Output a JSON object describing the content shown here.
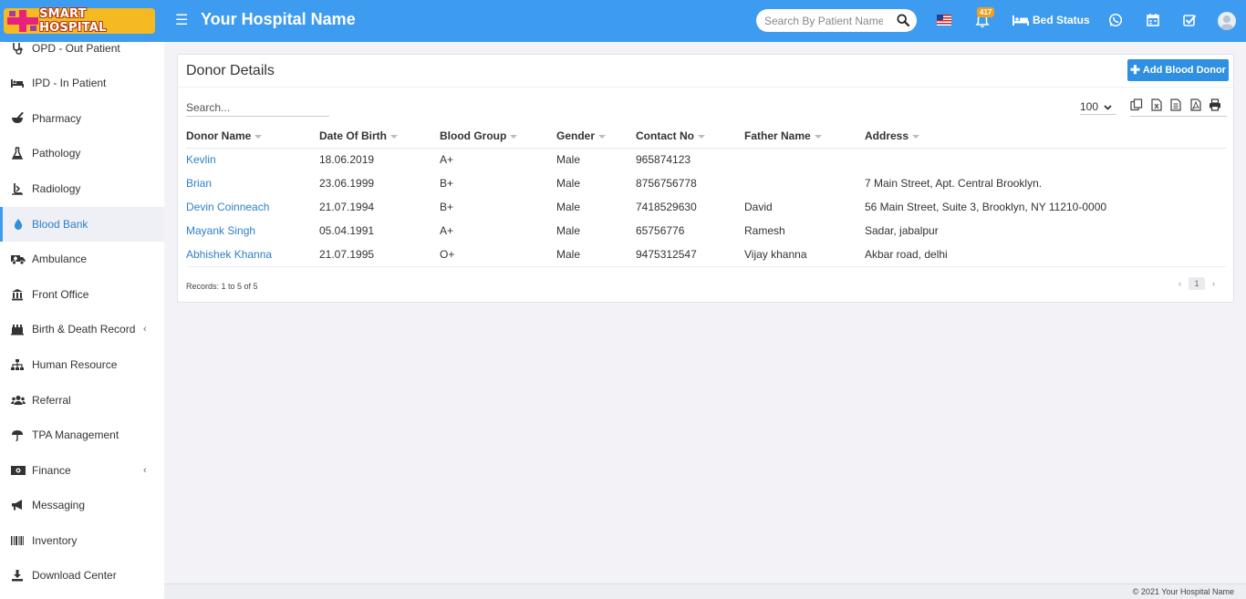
{
  "header": {
    "logo_text": "SMART HOSPITAL",
    "hospital_name": "Your Hospital Name",
    "search_placeholder": "Search By Patient Name",
    "notification_count": "417",
    "bed_status_label": "Bed Status"
  },
  "sidebar": {
    "items": [
      {
        "label": "OPD - Out Patient",
        "icon": "stethoscope-icon"
      },
      {
        "label": "IPD - In Patient",
        "icon": "bed-icon"
      },
      {
        "label": "Pharmacy",
        "icon": "mortar-pestle-icon"
      },
      {
        "label": "Pathology",
        "icon": "flask-icon"
      },
      {
        "label": "Radiology",
        "icon": "xray-icon"
      },
      {
        "label": "Blood Bank",
        "icon": "blood-drop-icon",
        "active": true
      },
      {
        "label": "Ambulance",
        "icon": "ambulance-icon"
      },
      {
        "label": "Front Office",
        "icon": "building-icon"
      },
      {
        "label": "Birth & Death Record",
        "icon": "baby-icon",
        "chevron": "‹"
      },
      {
        "label": "Human Resource",
        "icon": "sitemap-icon"
      },
      {
        "label": "Referral",
        "icon": "users-icon"
      },
      {
        "label": "TPA Management",
        "icon": "umbrella-icon"
      },
      {
        "label": "Finance",
        "icon": "money-icon",
        "chevron": "‹"
      },
      {
        "label": "Messaging",
        "icon": "bullhorn-icon"
      },
      {
        "label": "Inventory",
        "icon": "barcode-icon"
      },
      {
        "label": "Download Center",
        "icon": "download-icon"
      }
    ]
  },
  "main": {
    "title": "Donor Details",
    "add_button_label": "Add Blood Donor",
    "search_placeholder": "Search...",
    "page_length": "100",
    "columns": [
      "Donor Name",
      "Date Of Birth",
      "Blood Group",
      "Gender",
      "Contact No",
      "Father Name",
      "Address"
    ],
    "rows": [
      [
        "Kevlin",
        "18.06.2019",
        "A+",
        "Male",
        "965874123",
        "",
        ""
      ],
      [
        "Brian",
        "23.06.1999",
        "B+",
        "Male",
        "8756756778",
        "",
        "7 Main Street, Apt. Central Brooklyn."
      ],
      [
        "Devin Coinneach",
        "21.07.1994",
        "B+",
        "Male",
        "7418529630",
        "David",
        "56 Main Street, Suite 3, Brooklyn, NY 11210-0000"
      ],
      [
        "Mayank Singh",
        "05.04.1991",
        "A+",
        "Male",
        "65756776",
        "Ramesh",
        "Sadar, jabalpur"
      ],
      [
        "Abhishek Khanna",
        "21.07.1995",
        "O+",
        "Male",
        "9475312547",
        "Vijay khanna",
        "Akbar road, delhi"
      ]
    ],
    "records_text": "Records: 1 to 5 of 5",
    "current_page": "1",
    "pager_prev": "‹",
    "pager_next": "›"
  },
  "footer": {
    "text": "© 2021 Your Hospital Name"
  },
  "colors": {
    "header_bg": "#3d9bf0",
    "link": "#2f7fc8",
    "button": "#2f8fe0",
    "badge": "#f0a020"
  }
}
